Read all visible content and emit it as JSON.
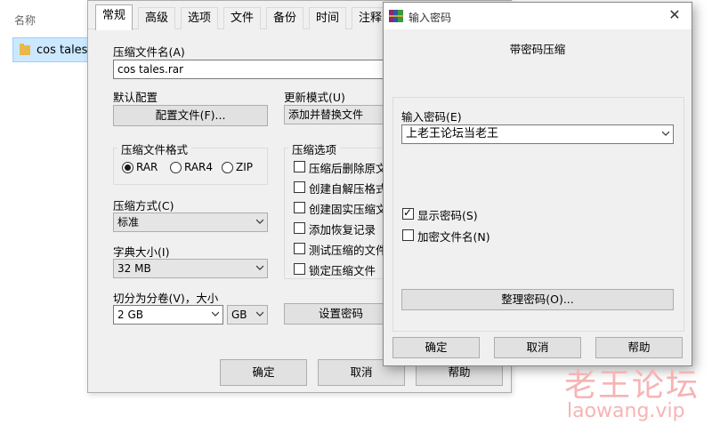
{
  "explorer": {
    "column_name": "名称",
    "file_name": "cos tales"
  },
  "archive_dialog": {
    "tabs": [
      "常规",
      "高级",
      "选项",
      "文件",
      "备份",
      "时间",
      "注释"
    ],
    "archive_name_label": "压缩文件名(A)",
    "archive_name_value": "cos tales.rar",
    "default_profile_label": "默认配置",
    "profile_button": "配置文件(F)...",
    "update_mode_label": "更新模式(U)",
    "update_mode_value": "添加并替换文件",
    "format_group": "压缩文件格式",
    "formats": [
      "RAR",
      "RAR4",
      "ZIP"
    ],
    "selected_format": "RAR",
    "options_group": "压缩选项",
    "options": [
      "压缩后删除原文件",
      "创建自解压格式",
      "创建固实压缩文件",
      "添加恢复记录",
      "测试压缩的文件",
      "锁定压缩文件"
    ],
    "method_label": "压缩方式(C)",
    "method_value": "标准",
    "dict_label": "字典大小(I)",
    "dict_value": "32 MB",
    "split_label": "切分为分卷(V)，大小",
    "split_value": "2 GB",
    "split_unit": "GB",
    "set_password_button": "设置密码",
    "ok": "确定",
    "cancel": "取消",
    "help": "帮助"
  },
  "password_dialog": {
    "title": "输入密码",
    "heading": "带密码压缩",
    "password_label": "输入密码(E)",
    "password_value": "上老王论坛当老王",
    "show_password": "显示密码(S)",
    "show_password_checked": true,
    "encrypt_names": "加密文件名(N)",
    "encrypt_names_checked": false,
    "organize_button": "整理密码(O)...",
    "ok": "确定",
    "cancel": "取消",
    "help": "帮助",
    "close_icon": "close-icon"
  },
  "watermark": {
    "line1": "老王论坛",
    "line2": "laowang.vip"
  },
  "colors": {
    "dialog_bg": "#f0f0f0",
    "selection": "#cce8ff",
    "watermark": "#f6b4b4"
  }
}
